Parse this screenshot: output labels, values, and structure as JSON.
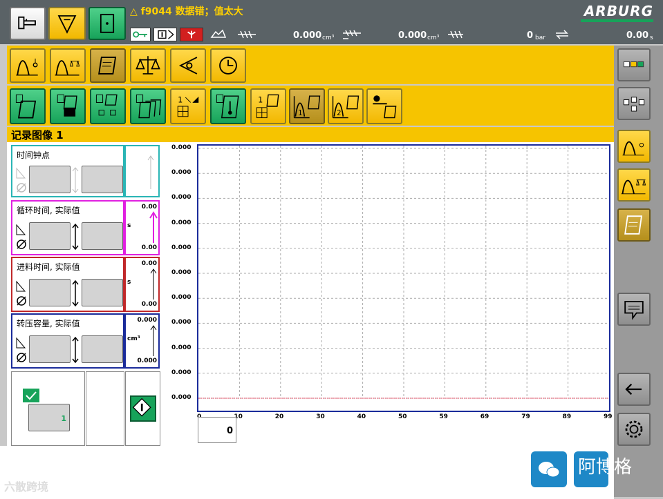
{
  "header": {
    "message": "△ f9044 数据错；值太大",
    "logo": "ARBURG",
    "stat1_value": "0.000",
    "stat1_unit": "cm³",
    "stat2_value": "0.000",
    "stat2_unit": "cm³",
    "stat3_value": "0",
    "stat3_unit": "bar",
    "stat4_value": "0.00",
    "stat4_unit": "s"
  },
  "page": {
    "title": "记录图像 1"
  },
  "cards": [
    {
      "label": "时间钟点",
      "top": "",
      "bottom": "",
      "unit": "",
      "color": "#2ab5b5"
    },
    {
      "label": "循环时间, 实际值",
      "top": "0.00",
      "bottom": "0.00",
      "unit": "s",
      "color": "#e020e0"
    },
    {
      "label": "进料时间, 实际值",
      "top": "0.00",
      "bottom": "0.00",
      "unit": "s",
      "color": "#c0282a"
    },
    {
      "label": "转压容量, 实际值",
      "top": "0.000",
      "bottom": "0.000",
      "unit": "cm³",
      "color": "#1a2b9a"
    }
  ],
  "bottom_left": {
    "counter_value": "1"
  },
  "chart": {
    "y_labels": [
      "0.000",
      "0.000",
      "0.000",
      "0.000",
      "0.000",
      "0.000",
      "0.000",
      "0.000",
      "0.000",
      "0.000",
      "0.000"
    ],
    "x_labels": [
      "0",
      "10",
      "20",
      "30",
      "40",
      "50",
      "59",
      "69",
      "79",
      "89",
      "99"
    ],
    "cursor_value": "0"
  },
  "chart_data": {
    "type": "line",
    "x": [
      0,
      99
    ],
    "y": [
      0,
      0
    ],
    "xlim": [
      0,
      99
    ],
    "ylim": [
      0,
      0
    ],
    "grid": true,
    "title": "",
    "xlabel": "",
    "ylabel": ""
  },
  "watermark": {
    "left_text": "六散跨境",
    "right_text": "阿博格"
  },
  "colors": {
    "accent": "#f6c400",
    "green": "#17a35a",
    "plot_border": "#1a2b9a",
    "curve": "#e0405a"
  }
}
